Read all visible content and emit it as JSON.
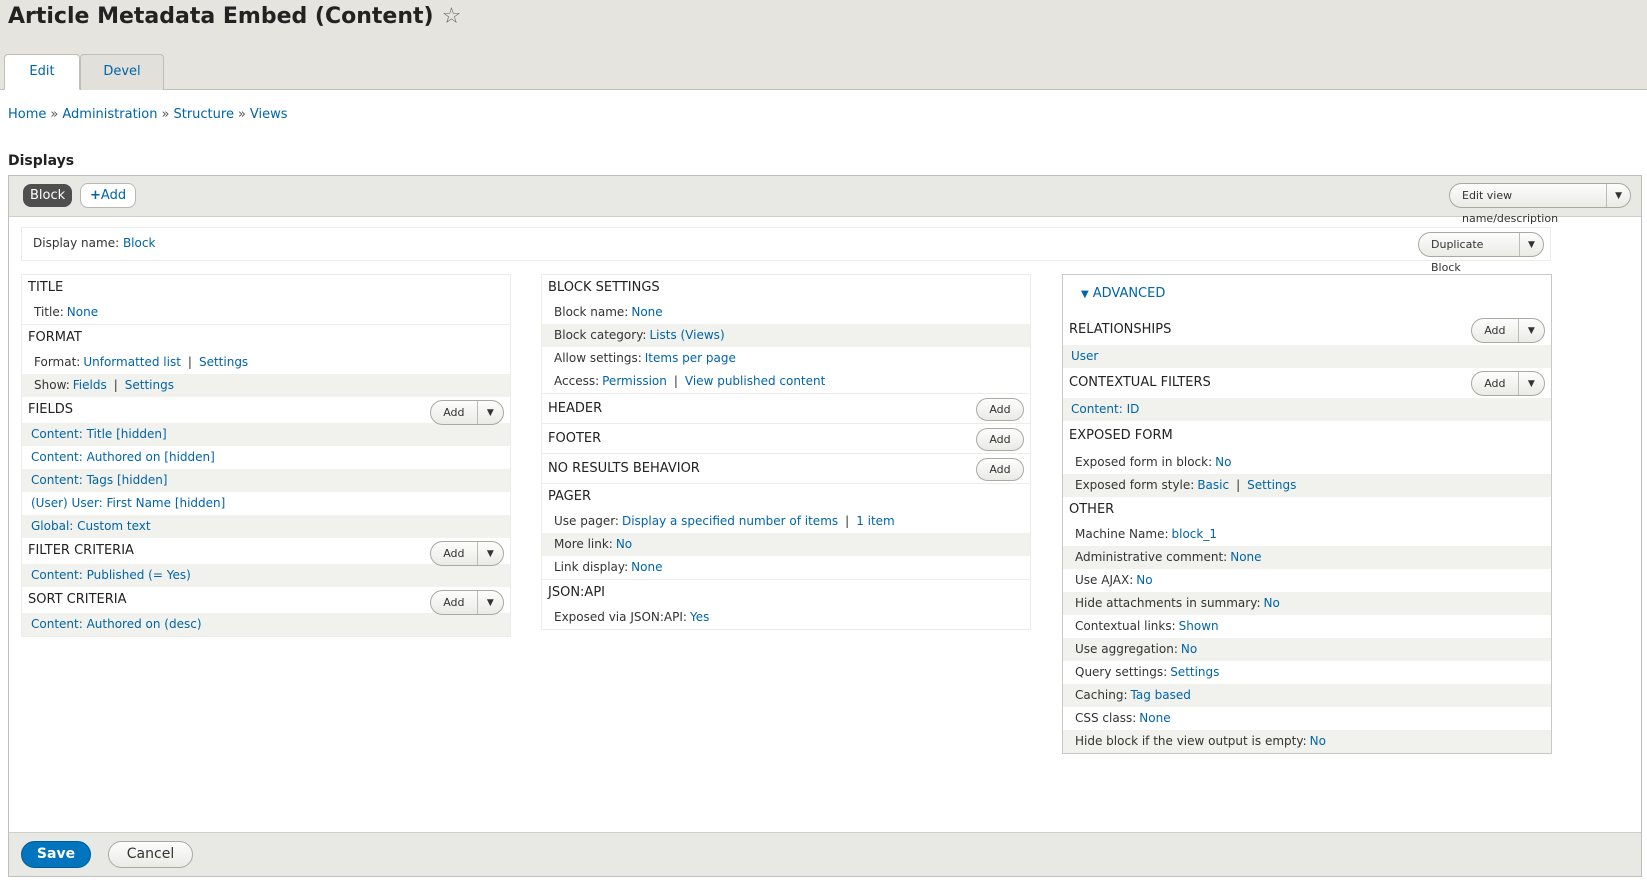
{
  "page": {
    "title": "Article Metadata Embed (Content)"
  },
  "tabs": [
    {
      "label": "Edit"
    },
    {
      "label": "Devel"
    }
  ],
  "breadcrumb": [
    "Home",
    "Administration",
    "Structure",
    "Views"
  ],
  "breadcrumb_sep": "»",
  "displays": {
    "heading": "Displays",
    "active_display": "Block",
    "add_label": "Add",
    "edit_view_label": "Edit view name/description",
    "display_name_label": "Display name:",
    "display_name_value": "Block",
    "duplicate_label": "Duplicate Block"
  },
  "col1": {
    "title": {
      "heading": "TITLE",
      "title_label": "Title:",
      "title_value": "None"
    },
    "format": {
      "heading": "FORMAT",
      "format_label": "Format:",
      "format_value": "Unformatted list",
      "format_settings": "Settings",
      "show_label": "Show:",
      "show_value": "Fields",
      "show_settings": "Settings"
    },
    "fields": {
      "heading": "FIELDS",
      "add": "Add",
      "items": [
        "Content: Title [hidden]",
        "Content: Authored on [hidden]",
        "Content: Tags [hidden]",
        "(User) User: First Name [hidden]",
        "Global: Custom text"
      ]
    },
    "filter": {
      "heading": "FILTER CRITERIA",
      "add": "Add",
      "items": [
        "Content: Published (= Yes)"
      ]
    },
    "sort": {
      "heading": "SORT CRITERIA",
      "add": "Add",
      "items": [
        "Content: Authored on (desc)"
      ]
    }
  },
  "col2": {
    "block": {
      "heading": "BLOCK SETTINGS",
      "name_label": "Block name:",
      "name_value": "None",
      "category_label": "Block category:",
      "category_value": "Lists (Views)",
      "allow_label": "Allow settings:",
      "allow_value": "Items per page",
      "access_label": "Access:",
      "access_value": "Permission",
      "access_value2": "View published content"
    },
    "header": {
      "heading": "HEADER",
      "add": "Add"
    },
    "footer": {
      "heading": "FOOTER",
      "add": "Add"
    },
    "noresults": {
      "heading": "NO RESULTS BEHAVIOR",
      "add": "Add"
    },
    "pager": {
      "heading": "PAGER",
      "use_label": "Use pager:",
      "use_value": "Display a specified number of items",
      "use_value2": "1 item",
      "more_label": "More link:",
      "more_value": "No",
      "link_label": "Link display:",
      "link_value": "None"
    },
    "jsonapi": {
      "heading": "JSON:API",
      "exposed_label": "Exposed via JSON:API:",
      "exposed_value": "Yes"
    }
  },
  "col3": {
    "advanced_label": "ADVANCED",
    "relationships": {
      "heading": "RELATIONSHIPS",
      "add": "Add",
      "items": [
        "User"
      ]
    },
    "contextual": {
      "heading": "CONTEXTUAL FILTERS",
      "add": "Add",
      "items": [
        "Content: ID"
      ]
    },
    "exposed": {
      "heading": "EXPOSED FORM",
      "block_label": "Exposed form in block:",
      "block_value": "No",
      "style_label": "Exposed form style:",
      "style_value": "Basic",
      "style_settings": "Settings"
    },
    "other": {
      "heading": "OTHER",
      "rows": [
        {
          "label": "Machine Name:",
          "value": "block_1"
        },
        {
          "label": "Administrative comment:",
          "value": "None"
        },
        {
          "label": "Use AJAX:",
          "value": "No"
        },
        {
          "label": "Hide attachments in summary:",
          "value": "No"
        },
        {
          "label": "Contextual links:",
          "value": "Shown"
        },
        {
          "label": "Use aggregation:",
          "value": "No"
        },
        {
          "label": "Query settings:",
          "value": "Settings"
        },
        {
          "label": "Caching:",
          "value": "Tag based"
        },
        {
          "label": "CSS class:",
          "value": "None"
        },
        {
          "label": "Hide block if the view output is empty:",
          "value": "No"
        }
      ]
    }
  },
  "actions": {
    "save": "Save",
    "cancel": "Cancel"
  },
  "colors": {
    "link": "#0064a8",
    "primary": "#0074bd",
    "header_bg": "#e5e4de"
  },
  "icons": {
    "favorite": "star-outline-icon",
    "dropdown": "caret-down-icon",
    "advanced": "triangle-down-icon"
  }
}
